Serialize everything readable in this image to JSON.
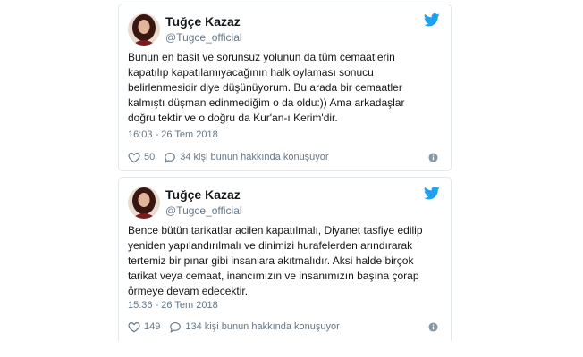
{
  "colors": {
    "twitter_blue": "#1da1f2",
    "text": "#14171a",
    "muted": "#657786",
    "border": "#e1e8ed"
  },
  "tweets": [
    {
      "name": "Tuğçe Kazaz",
      "handle": "@Tugce_official",
      "text": "Bunun en basit ve sorunsuz yolunun da tüm cemaatlerin\nkapatılıp kapatılamıyacağının halk oylaması sonucu\nbelirlenmesidir diye düşünüyorum. Bu arada bir cemaatler\nkalmıştı düşman edinmediğim o da oldu:)) Ama arkadaşlar\ndoğru tektir ve o doğru da Kur'an-ı Kerim'dir.",
      "timestamp": "16:03 - 26 Tem 2018",
      "likes": "50",
      "replies": "34 kişi bunun hakkında konuşuyor",
      "icons": {
        "like": "heart-icon",
        "reply": "comment-icon",
        "info": "info-icon",
        "brand": "twitter-bird-icon"
      }
    },
    {
      "name": "Tuğçe Kazaz",
      "handle": "@Tugce_official",
      "text": "Bence bütün tarikatlar acilen kapatılmalı, Diyanet tasfiye edilip\nyeniden yapılandırılmalı ve dinimizi hurafelerden arındırarak\ntertemiz bir pınar gibi insanlara akıtmalıdır. Aksi halde birçok\ntarikat veya cemaat, inancımızın ve insanımızın başına çorap\nörmeye devam edecektir.",
      "timestamp": "15:36 - 26 Tem 2018",
      "likes": "149",
      "replies": "134 kişi bunun hakkında konuşuyor",
      "icons": {
        "like": "heart-icon",
        "reply": "comment-icon",
        "info": "info-icon",
        "brand": "twitter-bird-icon"
      }
    }
  ]
}
